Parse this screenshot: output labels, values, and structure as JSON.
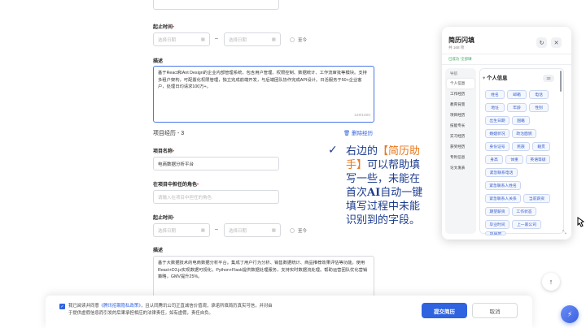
{
  "form": {
    "end_time_label": "起止时间",
    "start_ph": "选择日期",
    "end_ph": "选择日期",
    "range_sep": "–",
    "present": "至今",
    "desc_label": "描述",
    "desc1_text": "基于React和Ant Design的企业内部管理系统，包含用户管理、权限控制、数据统计、工作流审批等模块。支持多租户架构，可配置化权限管理，独立完成前端开发，与后端团队协作完成API设计。日活服务于50+企业客户，处理日均请求100万+。",
    "desc1_count": "129/1000",
    "project3_title": "项目经历 - 3",
    "delete_label": "删除经历",
    "proj_name_label": "项目名称",
    "proj_name_value": "电商数据分析平台",
    "role_label": "在项目中担任的角色",
    "role_ph": "请输入在项目中担任的角色",
    "desc2_text": "基于大数据技术的电商数据分析平台。集成了用户行为分析、销售数据统计、商品推荐效果评估等功能。使用React+D3.js实现数据可视化，Python+Flask提供数据处理服务，支持实时数据流处理。帮助运营团队优化营销策略，GMV提升25%。"
  },
  "annotation": {
    "check": "✓",
    "line1_pre": "右边的",
    "line1_hl": "【简历助",
    "line2_hl": "手】",
    "line2_post": "可以帮助填",
    "line3": "写一些，未能在",
    "line4_pre": "首次",
    "line4_bold": "AI",
    "line4_post": "自动一键",
    "line5": "填写过程中未能",
    "line6": "识别到的字段。"
  },
  "panel": {
    "title": "简历闪填",
    "subtitle": "共 168 项",
    "status": "已成功 '全部填'",
    "nav": [
      "导航",
      "个人信息",
      "工作经历",
      "教育背景",
      "项目经历",
      "技能专长",
      "实习经历",
      "获奖经历",
      "专利信息",
      "论文发表"
    ],
    "section_title": "个人信息",
    "section_count": "32",
    "tags": [
      "姓名",
      "邮箱",
      "电话",
      "地址",
      "年龄",
      "性别",
      "出生日期",
      "国籍",
      "婚姻状况",
      "政治面貌",
      "身份证号",
      "民族",
      "籍贯",
      "身高",
      "体重",
      "英语等级",
      "紧急联系电话",
      "紧急联系人姓名",
      "紧急联系人关系",
      "当前薪资",
      "期望薪资",
      "工作状态",
      "毕业时间",
      "上一家公司",
      "现居地"
    ]
  },
  "footer": {
    "agree_pre": "我已阅读并同意",
    "agree_link": "《腾讯招聘隐私政策》",
    "agree_post": "，且认同腾讯公司正直诚信价值观，承诺所填简历真实可信，并对由",
    "agree_line2": "于提供虚假信息而引发的后果承担相应的法律责任，如有虚假，责任自负。",
    "submit": "提交简历",
    "cancel": "取消"
  },
  "colors": {
    "accent": "#2f63e0",
    "highlight": "#e8781c",
    "annotation": "#1d3d8f"
  }
}
